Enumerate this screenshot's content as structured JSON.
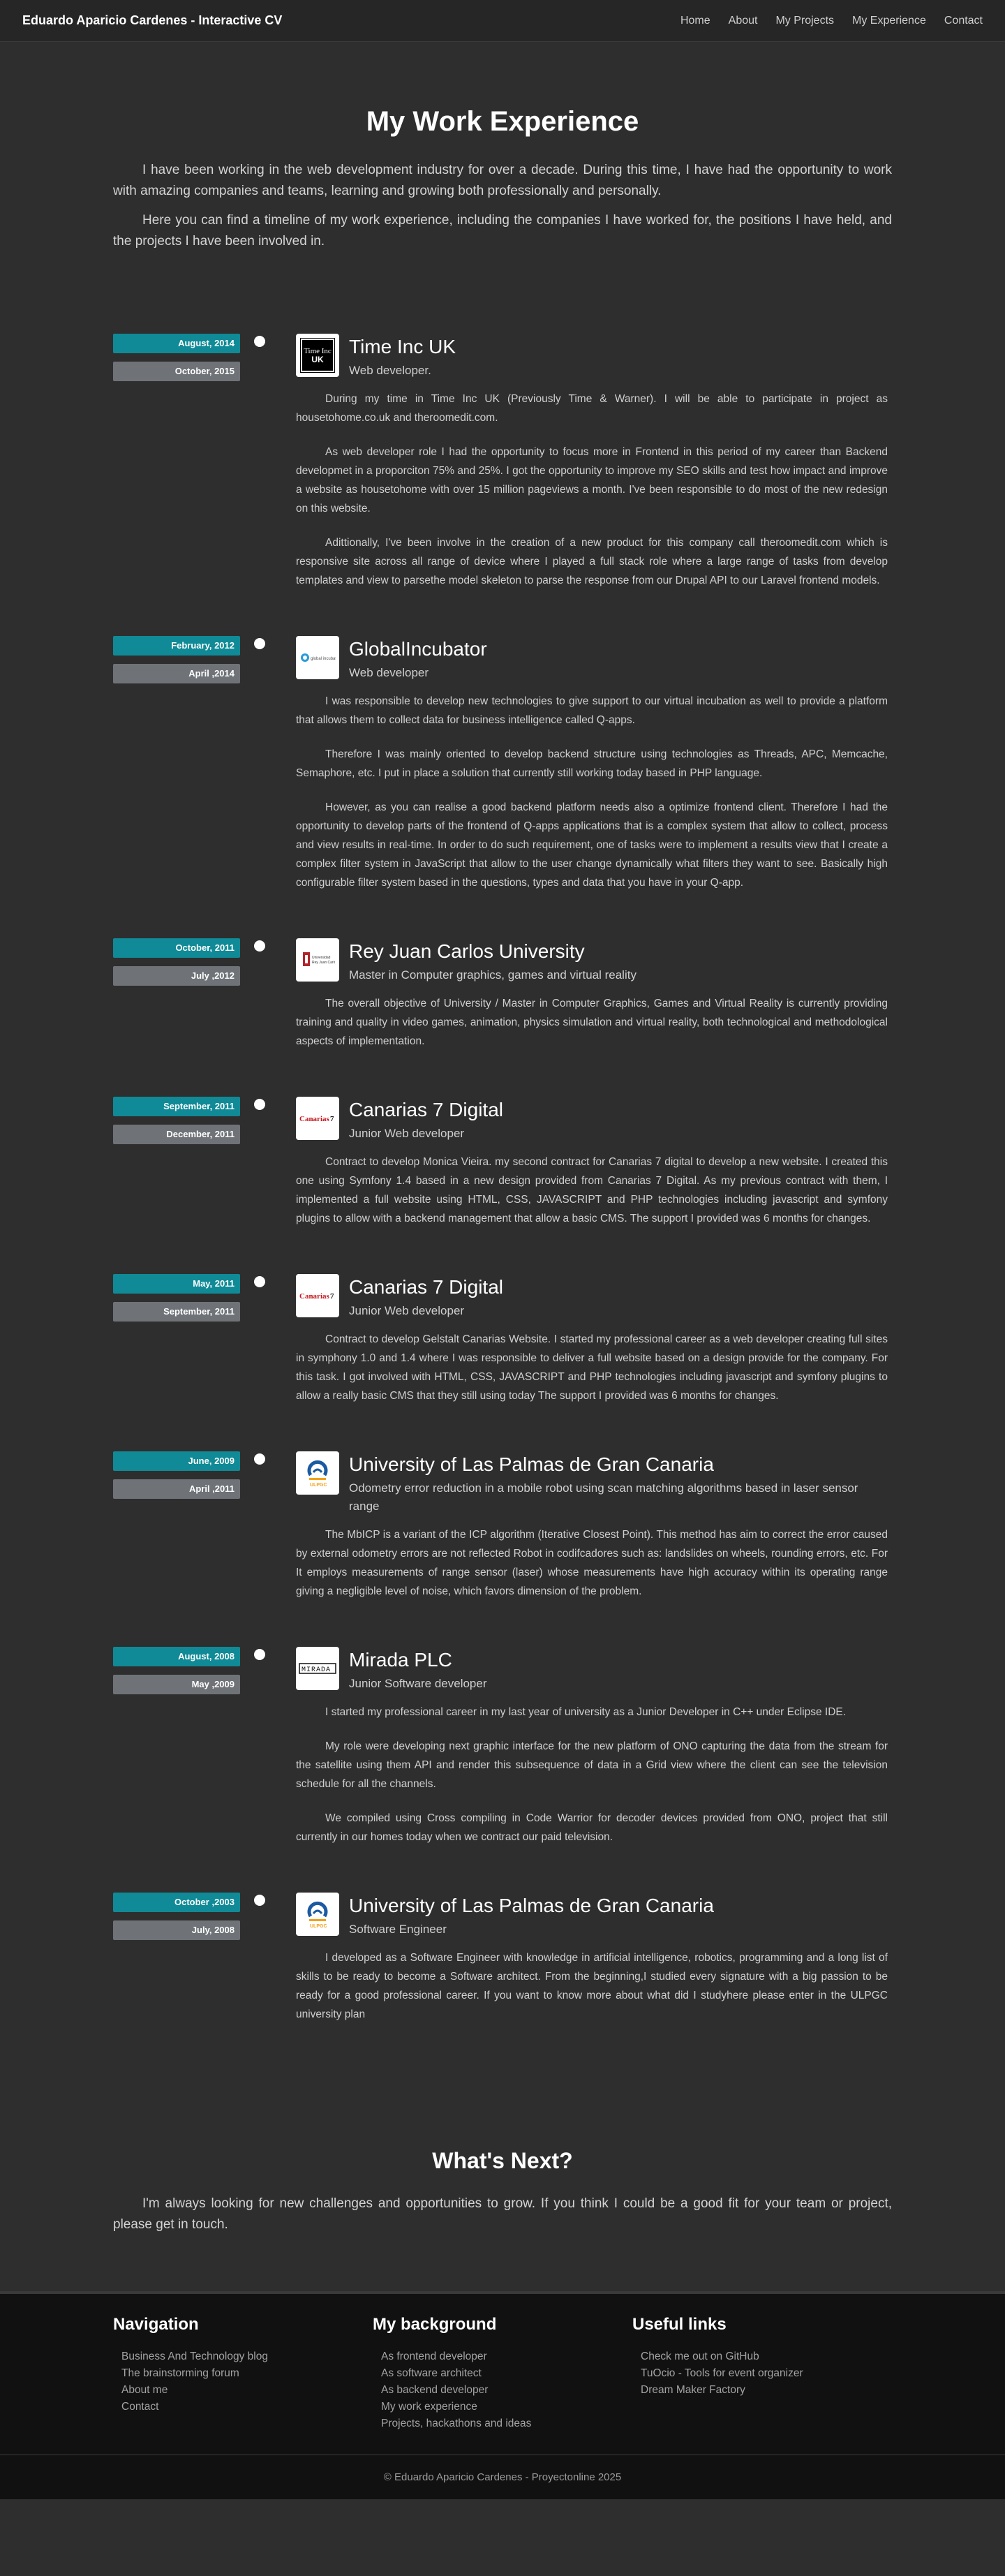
{
  "nav": {
    "brand": "Eduardo Aparicio Cardenes - Interactive CV",
    "links": [
      "Home",
      "About",
      "My Projects",
      "My Experience",
      "Contact"
    ]
  },
  "hero": {
    "title": "My Work Experience",
    "paragraphs": [
      "I have been working in the web development industry for over a decade. During this time, I have had the opportunity to work with amazing companies and teams, learning and growing both professionally and personally.",
      "Here you can find a timeline of my work experience, including the companies I have worked for, the positions I have held, and the projects I have been involved in."
    ]
  },
  "colors": {
    "start_badge": "#0f8a96",
    "end_badge": "#6f7378",
    "background": "#2e2e2e",
    "footer": "#111111"
  },
  "experience": [
    {
      "start": "August, 2014",
      "end": "October, 2015",
      "logo": "timeinc-logo",
      "logo_text": "Time Inc UK",
      "company": "Time Inc UK",
      "role": "Web developer.",
      "paragraphs": [
        "During my time in Time Inc UK (Previously Time & Warner). I will be able to participate in project as housetohome.co.uk and theroomedit.com.",
        "As web developer role I had the opportunity to focus more in Frontend in this period of my career than Backend developmet in a proporciton 75% and 25%. I got the opportunity to improve my SEO skills and test how impact and improve a website as housetohome with over 15 million pageviews a month. I've been responsible to do most of the new redesign on this website.",
        "Adittionally, I've been involve in the creation of a new product for this company call theroomedit.com which is responsive site across all range of device where I played a full stack role where a large range of tasks from develop templates and view to parsethe model skeleton to parse the response from our Drupal API to our Laravel frontend models."
      ]
    },
    {
      "start": "February, 2012",
      "end": "April ,2014",
      "logo": "globalincubator-logo",
      "logo_text": "global incubator",
      "company": "GlobalIncubator",
      "role": "Web developer",
      "paragraphs": [
        "I was responsible to develop new technologies to give support to our virtual incubation as well to provide a platform that allows them to collect data for business intelligence called Q-apps.",
        "Therefore I was mainly oriented to develop backend structure using technologies as Threads, APC, Memcache, Semaphore, etc. I put in place a solution that currently still working today based in PHP language.",
        "However, as you can realise a good backend platform needs also a optimize frontend client. Therefore I had the opportunity to develop parts of the frontend of Q-apps applications that is a complex system that allow to collect, process and view results in real-time. In order to do such requirement, one of tasks were to implement a results view that I create a complex filter system in JavaScript that allow to the user change dynamically what filters they want to see. Basically high configurable filter system based in the questions, types and data that you have in your Q-app."
      ]
    },
    {
      "start": "October, 2011",
      "end": "July ,2012",
      "logo": "urjc-logo",
      "logo_text": "Universidad Rey Juan Carlos",
      "company": "Rey Juan Carlos University",
      "role": "Master in Computer graphics, games and virtual reality",
      "paragraphs": [
        "The overall objective of University / Master in Computer Graphics, Games and Virtual Reality is currently providing training and quality in video games, animation, physics simulation and virtual reality, both technological and methodological aspects of implementation."
      ]
    },
    {
      "start": "September, 2011",
      "end": "December, 2011",
      "logo": "canarias7-logo",
      "logo_text": "Canarias7",
      "company": "Canarias 7 Digital",
      "role": "Junior Web developer",
      "paragraphs": [
        "Contract to develop Monica Vieira. my second contract for Canarias 7 digital to develop a new website. I created this one using Symfony 1.4 based in a new design provided from Canarias 7 Digital. As my previous contract with them, I implemented a full website using HTML, CSS, JAVASCRIPT and PHP technologies including javascript and symfony plugins to allow with a backend management that allow a basic CMS. The support I provided was 6 months for changes."
      ]
    },
    {
      "start": "May, 2011",
      "end": "September, 2011",
      "logo": "canarias7-logo",
      "logo_text": "Canarias7",
      "company": "Canarias 7 Digital",
      "role": "Junior Web developer",
      "paragraphs": [
        "Contract to develop Gelstalt Canarias Website. I started my professional career as a web developer creating full sites in symphony 1.0 and 1.4 where I was responsible to deliver a full website based on a design provide for the company. For this task. I got involved with HTML, CSS, JAVASCRIPT and PHP technologies including javascript and symfony plugins to allow a really basic CMS that they still using today The support I provided was 6 months for changes."
      ]
    },
    {
      "start": "June, 2009",
      "end": "April ,2011",
      "logo": "ulpgc-logo",
      "logo_text": "ULPGC",
      "company": "University of Las Palmas de Gran Canaria",
      "role": "Odometry error reduction in a mobile robot using scan matching algorithms based in laser sensor range",
      "paragraphs": [
        "The MbICP is a variant of the ICP algorithm (Iterative Closest Point). This method has aim to correct the error caused by external odometry errors are not reflected Robot in codifcadores such as: landslides on wheels, rounding errors, etc. For It employs measurements of range sensor (laser) whose measurements have high accuracy within its operating range giving a negligible level of noise, which favors dimension of the problem."
      ]
    },
    {
      "start": "August, 2008",
      "end": "May ,2009",
      "logo": "mirada-logo",
      "logo_text": "MIRADA",
      "company": "Mirada PLC",
      "role": "Junior Software developer",
      "paragraphs": [
        "I started my professional career in my last year of university as a Junior Developer in C++ under Eclipse IDE.",
        "My role were developing next graphic interface for the new platform of ONO capturing the data from the stream for the satellite using them API and render this subsequence of data in a Grid view where the client can see the television schedule for all the channels.",
        "We compiled using Cross compiling in Code Warrior for decoder devices provided from ONO, project that still currently in our homes today when we contract our paid television."
      ]
    },
    {
      "start": "October ,2003",
      "end": "July, 2008",
      "logo": "ulpgc-logo",
      "logo_text": "ULPGC",
      "company": "University of Las Palmas de Gran Canaria",
      "role": "Software Engineer",
      "paragraphs": [
        "I developed as a Software Engineer with knowledge in artificial intelligence, robotics, programming and a long list of skills to be ready to become a Software architect. From the beginning,I studied every signature with a big passion to be ready for a good professional career. If you want to know more about what did I studyhere please enter in the ULPGC university plan"
      ]
    }
  ],
  "next": {
    "title": "What's Next?",
    "text": "I'm always looking for new challenges and opportunities to grow. If you think I could be a good fit for your team or project, please get in touch."
  },
  "footer": {
    "columns": [
      {
        "title": "Navigation",
        "items": [
          "Business And Technology blog",
          "The brainstorming forum",
          "About me",
          "Contact"
        ]
      },
      {
        "title": "My background",
        "items": [
          "As frontend developer",
          "As software architect",
          "As backend developer",
          "My work experience",
          "Projects, hackathons and ideas"
        ]
      },
      {
        "title": "Useful links",
        "items": [
          "Check me out on GitHub",
          "TuOcio - Tools for event organizer",
          "Dream Maker Factory"
        ]
      }
    ],
    "copyright": "© Eduardo Aparicio Cardenes - Proyectonline 2025"
  }
}
